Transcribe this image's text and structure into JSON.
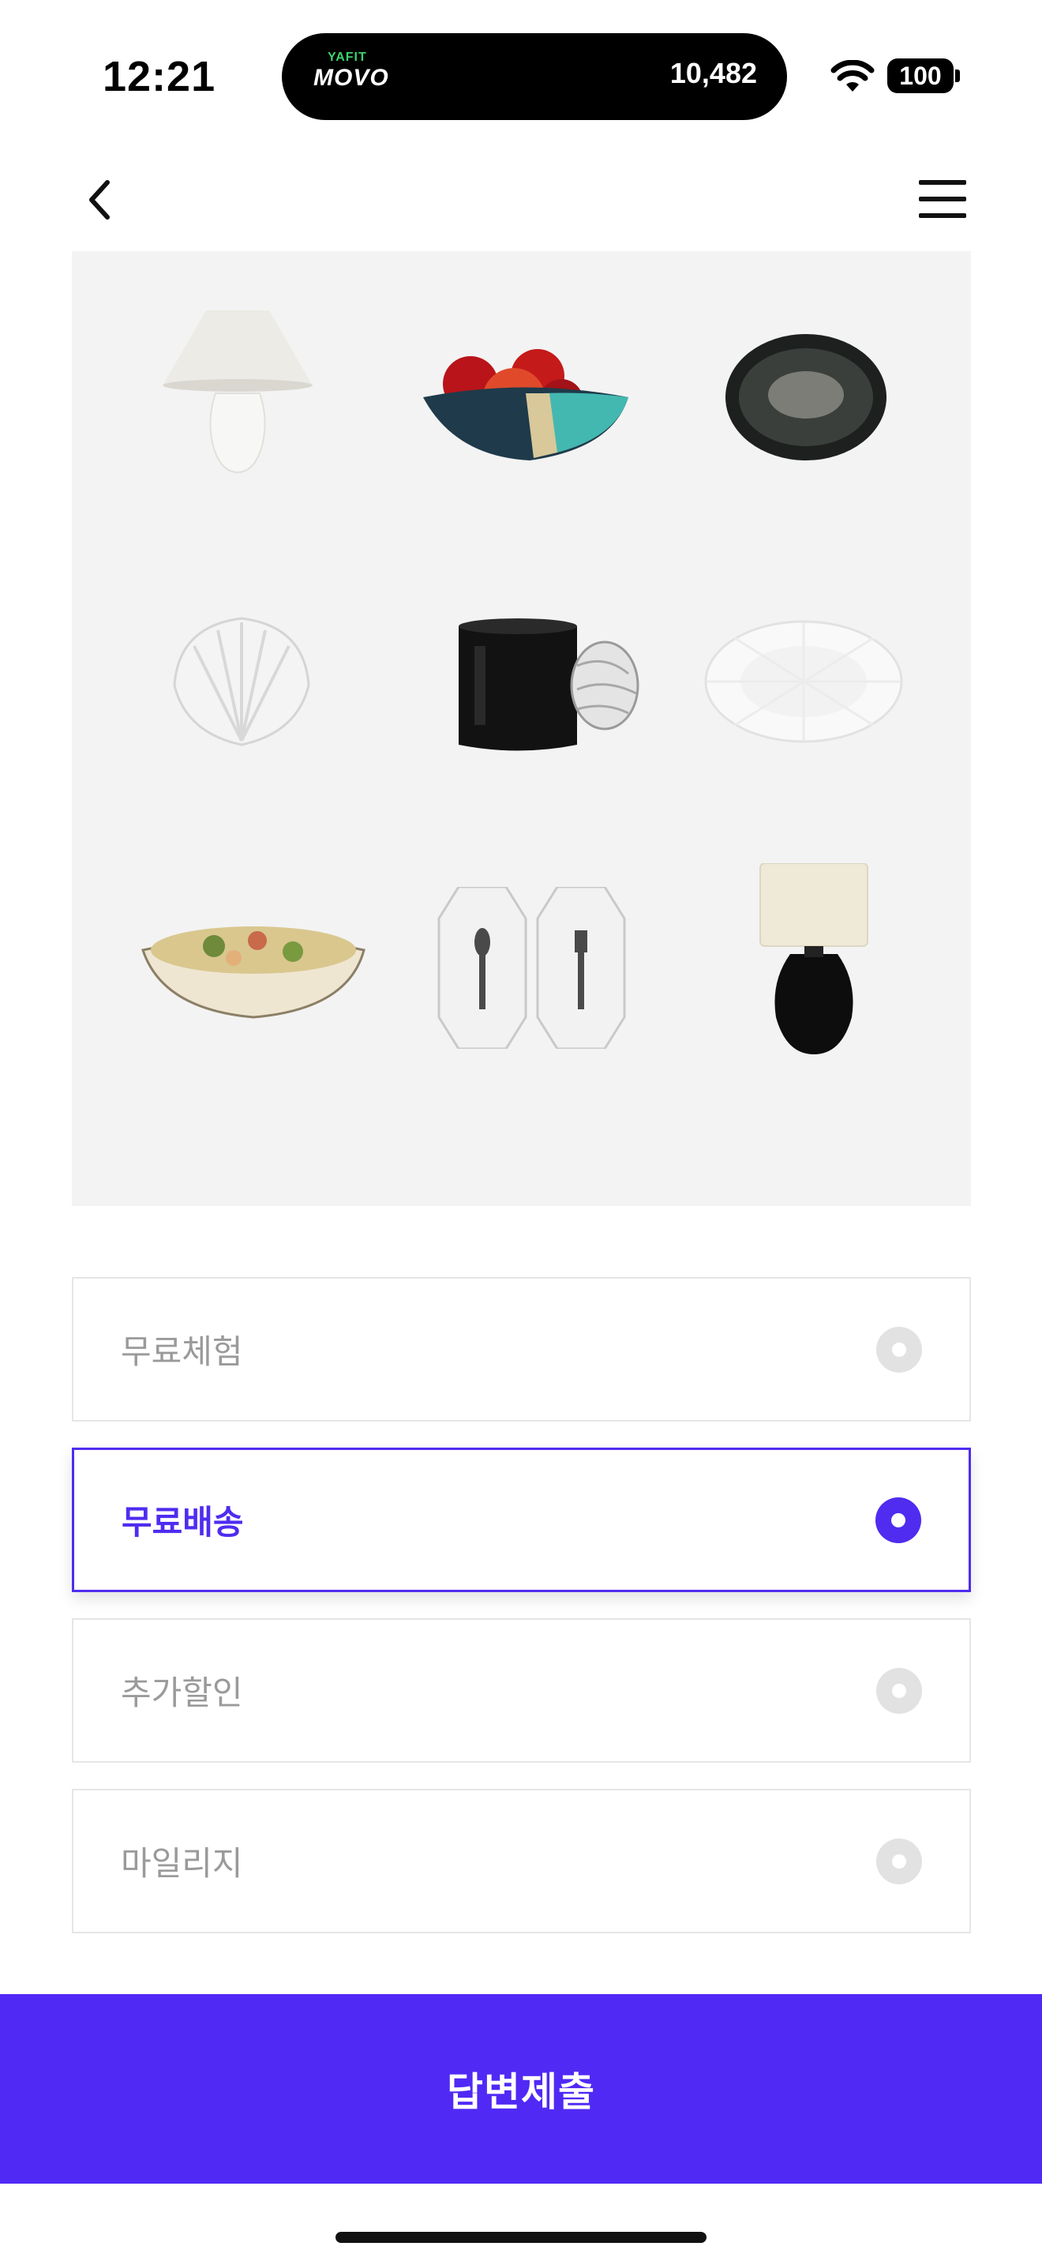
{
  "status_bar": {
    "time": "12:21",
    "island_logo_top": "YAFIT",
    "island_logo_main": "MOVO",
    "island_count": "10,482",
    "battery": "100"
  },
  "nav": {
    "back_icon": "chevron-left-icon",
    "menu_icon": "hamburger-menu-icon"
  },
  "products": [
    "table-lamp-white",
    "fruit-bowl-teal",
    "dark-oval-plate",
    "shell-dish-white",
    "black-mug",
    "flower-plate-white",
    "pasta-bowl",
    "octagon-cutlery-trays",
    "table-lamp-black"
  ],
  "options": [
    {
      "label": "무료체험",
      "selected": false
    },
    {
      "label": "무료배송",
      "selected": true
    },
    {
      "label": "추가할인",
      "selected": false
    },
    {
      "label": "마일리지",
      "selected": false
    }
  ],
  "submit": {
    "label": "답변제출"
  },
  "colors": {
    "accent": "#5029f5",
    "option_border": "#e6e6e6",
    "grid_bg": "#f3f3f3"
  }
}
